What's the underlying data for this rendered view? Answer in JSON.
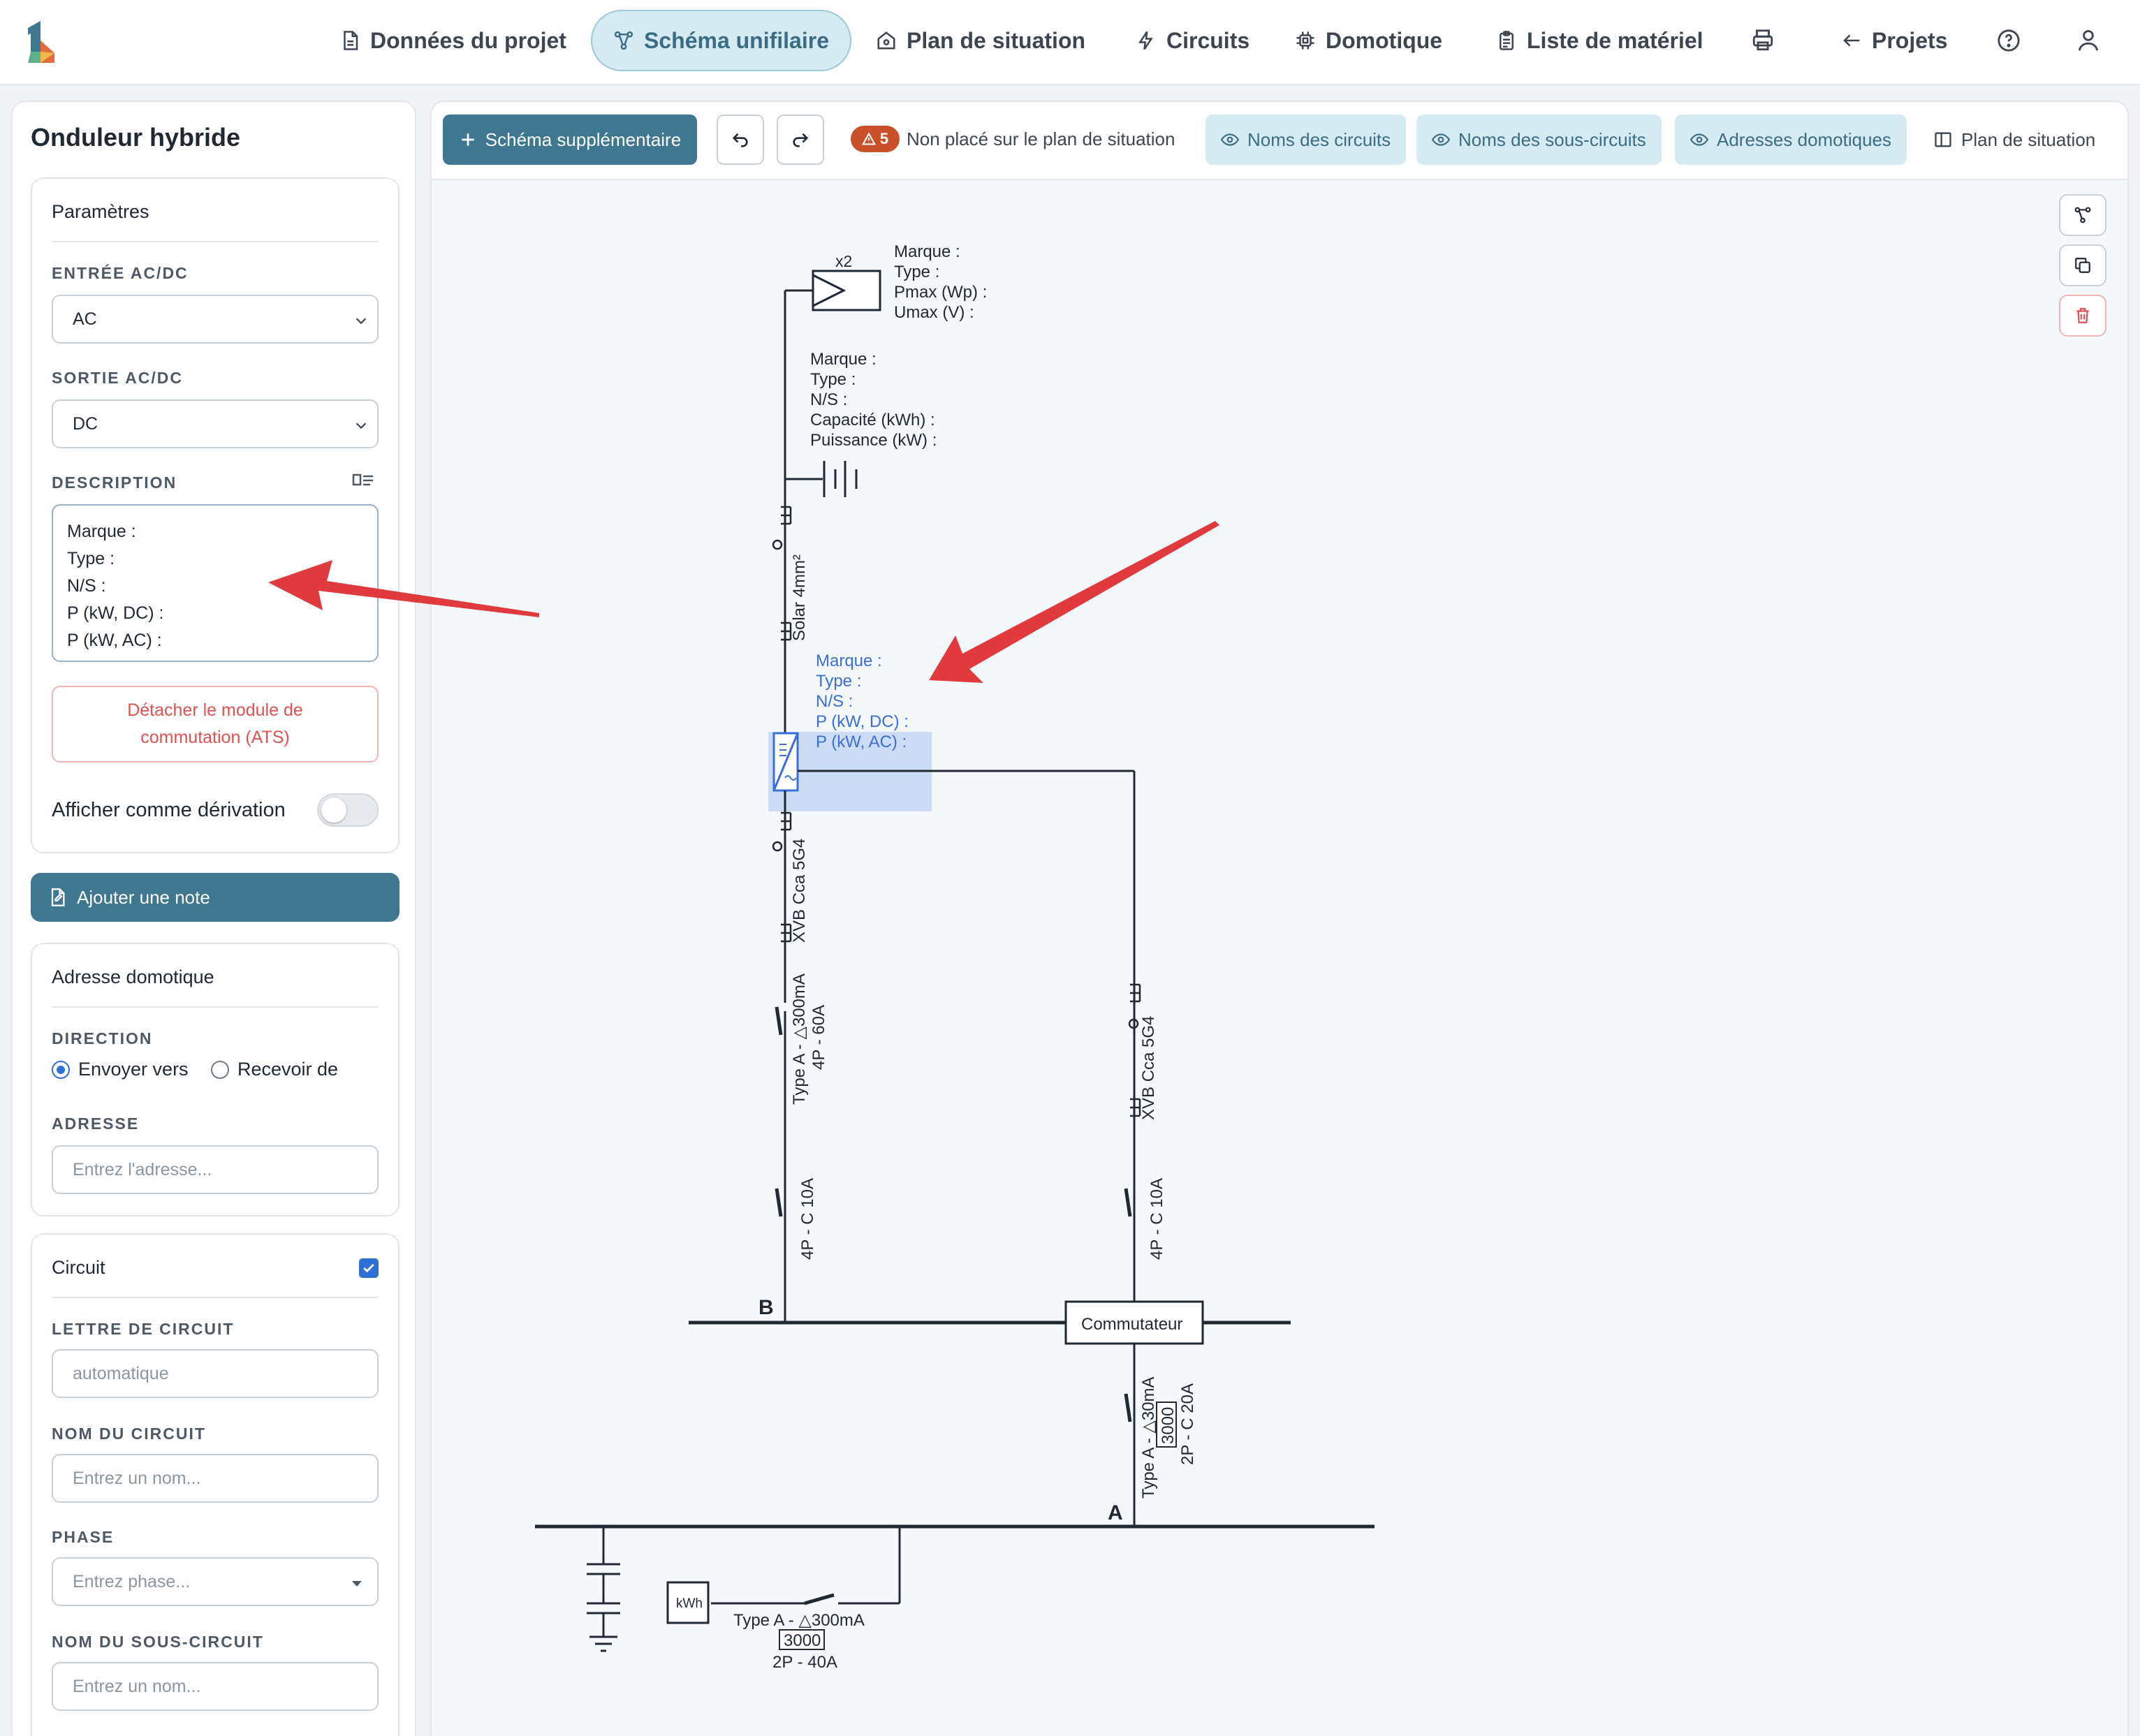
{
  "nav": {
    "items": [
      {
        "id": "donnees",
        "label": "Données du projet",
        "icon": "document-icon"
      },
      {
        "id": "schema",
        "label": "Schéma unifilaire",
        "icon": "diagram-icon",
        "active": true
      },
      {
        "id": "plan",
        "label": "Plan de situation",
        "icon": "home-icon"
      },
      {
        "id": "circuits",
        "label": "Circuits",
        "icon": "bolt-icon"
      },
      {
        "id": "domotique",
        "label": "Domotique",
        "icon": "chip-icon"
      },
      {
        "id": "materiel",
        "label": "Liste de matériel",
        "icon": "clipboard-icon"
      }
    ],
    "projects_label": "Projets"
  },
  "left_panel": {
    "title": "Onduleur hybride",
    "parametres": {
      "header": "Paramètres",
      "entree_label": "ENTRÉE AC/DC",
      "entree_value": "AC",
      "sortie_label": "SORTIE AC/DC",
      "sortie_value": "DC",
      "description_label": "DESCRIPTION",
      "description_value": "Marque :\nType :\nN/S :\nP (kW, DC) :\nP (kW, AC) :",
      "detach_button": "Détacher le module de commutation (ATS)",
      "derivation_label": "Afficher comme dérivation",
      "derivation_on": false
    },
    "add_note_button": "Ajouter une note",
    "domotique": {
      "header": "Adresse domotique",
      "direction_label": "DIRECTION",
      "send_label": "Envoyer vers",
      "receive_label": "Recevoir de",
      "address_label": "ADRESSE",
      "address_placeholder": "Entrez l'adresse..."
    },
    "circuit": {
      "header": "Circuit",
      "checked": true,
      "letter_label": "LETTRE DE CIRCUIT",
      "letter_placeholder": "automatique",
      "name_label": "NOM DU CIRCUIT",
      "name_placeholder": "Entrez un nom...",
      "phase_label": "PHASE",
      "phase_placeholder": "Entrez phase...",
      "subcircuit_label": "NOM DU SOUS-CIRCUIT",
      "subcircuit_placeholder": "Entrez un nom..."
    }
  },
  "toolbar": {
    "add_scheme": "Schéma supplémentaire",
    "warning_count": "5",
    "warning_text": "Non placé sur le plan de situation",
    "toggle_circuits": "Noms des circuits",
    "toggle_subcircuits": "Noms des sous-circuits",
    "toggle_domotique": "Adresses domotiques",
    "plan_label": "Plan de situation"
  },
  "schema": {
    "panel_multiplier": "x2",
    "panel_props": [
      "Marque :",
      "Type :",
      "Pmax (Wp) :",
      "Umax (V) :"
    ],
    "battery_props": [
      "Marque :",
      "Type :",
      "N/S :",
      "Capacité (kWh) :",
      "Puissance (kW) :"
    ],
    "cable_solar": "Solar 4mm²",
    "inverter_props": [
      "Marque :",
      "Type :",
      "N/S :",
      "P (kW, DC) :",
      "P (kW, AC) :"
    ],
    "cable_left": "XVB Cca 5G4",
    "cable_right": "XVB Cca 5G4",
    "diff_left_type": "Type A -  △300mA",
    "diff_left_rating": "4P - 60A",
    "breaker_left": "4P - C 10A",
    "breaker_right": "4P - C 10A",
    "bus_b": "B",
    "commutateur": "Commutateur",
    "diff_main_type": "Type A -  △30mA",
    "diff_main_box": "3000",
    "diff_main_rating": "2P - C 20A",
    "bus_a": "A",
    "meter": "kWh",
    "diff_supply_type": "Type A -  △300mA",
    "diff_supply_box": "3000",
    "diff_supply_rating": "2P - 40A"
  },
  "colors": {
    "accent": "#3f7690",
    "accent_light": "#d6eaf2",
    "selection": "#3a6fd8",
    "annotation_arrow": "#e0393e",
    "warning": "#c9502a",
    "danger": "#e05252"
  }
}
